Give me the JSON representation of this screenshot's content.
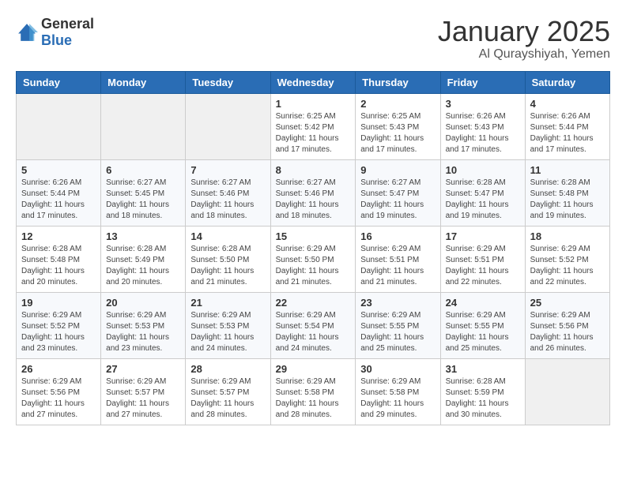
{
  "logo": {
    "general": "General",
    "blue": "Blue"
  },
  "header": {
    "month": "January 2025",
    "location": "Al Qurayshiyah, Yemen"
  },
  "weekdays": [
    "Sunday",
    "Monday",
    "Tuesday",
    "Wednesday",
    "Thursday",
    "Friday",
    "Saturday"
  ],
  "rows": [
    [
      {
        "day": "",
        "sunrise": "",
        "sunset": "",
        "daylight": ""
      },
      {
        "day": "",
        "sunrise": "",
        "sunset": "",
        "daylight": ""
      },
      {
        "day": "",
        "sunrise": "",
        "sunset": "",
        "daylight": ""
      },
      {
        "day": "1",
        "sunrise": "Sunrise: 6:25 AM",
        "sunset": "Sunset: 5:42 PM",
        "daylight": "Daylight: 11 hours and 17 minutes."
      },
      {
        "day": "2",
        "sunrise": "Sunrise: 6:25 AM",
        "sunset": "Sunset: 5:43 PM",
        "daylight": "Daylight: 11 hours and 17 minutes."
      },
      {
        "day": "3",
        "sunrise": "Sunrise: 6:26 AM",
        "sunset": "Sunset: 5:43 PM",
        "daylight": "Daylight: 11 hours and 17 minutes."
      },
      {
        "day": "4",
        "sunrise": "Sunrise: 6:26 AM",
        "sunset": "Sunset: 5:44 PM",
        "daylight": "Daylight: 11 hours and 17 minutes."
      }
    ],
    [
      {
        "day": "5",
        "sunrise": "Sunrise: 6:26 AM",
        "sunset": "Sunset: 5:44 PM",
        "daylight": "Daylight: 11 hours and 17 minutes."
      },
      {
        "day": "6",
        "sunrise": "Sunrise: 6:27 AM",
        "sunset": "Sunset: 5:45 PM",
        "daylight": "Daylight: 11 hours and 18 minutes."
      },
      {
        "day": "7",
        "sunrise": "Sunrise: 6:27 AM",
        "sunset": "Sunset: 5:46 PM",
        "daylight": "Daylight: 11 hours and 18 minutes."
      },
      {
        "day": "8",
        "sunrise": "Sunrise: 6:27 AM",
        "sunset": "Sunset: 5:46 PM",
        "daylight": "Daylight: 11 hours and 18 minutes."
      },
      {
        "day": "9",
        "sunrise": "Sunrise: 6:27 AM",
        "sunset": "Sunset: 5:47 PM",
        "daylight": "Daylight: 11 hours and 19 minutes."
      },
      {
        "day": "10",
        "sunrise": "Sunrise: 6:28 AM",
        "sunset": "Sunset: 5:47 PM",
        "daylight": "Daylight: 11 hours and 19 minutes."
      },
      {
        "day": "11",
        "sunrise": "Sunrise: 6:28 AM",
        "sunset": "Sunset: 5:48 PM",
        "daylight": "Daylight: 11 hours and 19 minutes."
      }
    ],
    [
      {
        "day": "12",
        "sunrise": "Sunrise: 6:28 AM",
        "sunset": "Sunset: 5:48 PM",
        "daylight": "Daylight: 11 hours and 20 minutes."
      },
      {
        "day": "13",
        "sunrise": "Sunrise: 6:28 AM",
        "sunset": "Sunset: 5:49 PM",
        "daylight": "Daylight: 11 hours and 20 minutes."
      },
      {
        "day": "14",
        "sunrise": "Sunrise: 6:28 AM",
        "sunset": "Sunset: 5:50 PM",
        "daylight": "Daylight: 11 hours and 21 minutes."
      },
      {
        "day": "15",
        "sunrise": "Sunrise: 6:29 AM",
        "sunset": "Sunset: 5:50 PM",
        "daylight": "Daylight: 11 hours and 21 minutes."
      },
      {
        "day": "16",
        "sunrise": "Sunrise: 6:29 AM",
        "sunset": "Sunset: 5:51 PM",
        "daylight": "Daylight: 11 hours and 21 minutes."
      },
      {
        "day": "17",
        "sunrise": "Sunrise: 6:29 AM",
        "sunset": "Sunset: 5:51 PM",
        "daylight": "Daylight: 11 hours and 22 minutes."
      },
      {
        "day": "18",
        "sunrise": "Sunrise: 6:29 AM",
        "sunset": "Sunset: 5:52 PM",
        "daylight": "Daylight: 11 hours and 22 minutes."
      }
    ],
    [
      {
        "day": "19",
        "sunrise": "Sunrise: 6:29 AM",
        "sunset": "Sunset: 5:52 PM",
        "daylight": "Daylight: 11 hours and 23 minutes."
      },
      {
        "day": "20",
        "sunrise": "Sunrise: 6:29 AM",
        "sunset": "Sunset: 5:53 PM",
        "daylight": "Daylight: 11 hours and 23 minutes."
      },
      {
        "day": "21",
        "sunrise": "Sunrise: 6:29 AM",
        "sunset": "Sunset: 5:53 PM",
        "daylight": "Daylight: 11 hours and 24 minutes."
      },
      {
        "day": "22",
        "sunrise": "Sunrise: 6:29 AM",
        "sunset": "Sunset: 5:54 PM",
        "daylight": "Daylight: 11 hours and 24 minutes."
      },
      {
        "day": "23",
        "sunrise": "Sunrise: 6:29 AM",
        "sunset": "Sunset: 5:55 PM",
        "daylight": "Daylight: 11 hours and 25 minutes."
      },
      {
        "day": "24",
        "sunrise": "Sunrise: 6:29 AM",
        "sunset": "Sunset: 5:55 PM",
        "daylight": "Daylight: 11 hours and 25 minutes."
      },
      {
        "day": "25",
        "sunrise": "Sunrise: 6:29 AM",
        "sunset": "Sunset: 5:56 PM",
        "daylight": "Daylight: 11 hours and 26 minutes."
      }
    ],
    [
      {
        "day": "26",
        "sunrise": "Sunrise: 6:29 AM",
        "sunset": "Sunset: 5:56 PM",
        "daylight": "Daylight: 11 hours and 27 minutes."
      },
      {
        "day": "27",
        "sunrise": "Sunrise: 6:29 AM",
        "sunset": "Sunset: 5:57 PM",
        "daylight": "Daylight: 11 hours and 27 minutes."
      },
      {
        "day": "28",
        "sunrise": "Sunrise: 6:29 AM",
        "sunset": "Sunset: 5:57 PM",
        "daylight": "Daylight: 11 hours and 28 minutes."
      },
      {
        "day": "29",
        "sunrise": "Sunrise: 6:29 AM",
        "sunset": "Sunset: 5:58 PM",
        "daylight": "Daylight: 11 hours and 28 minutes."
      },
      {
        "day": "30",
        "sunrise": "Sunrise: 6:29 AM",
        "sunset": "Sunset: 5:58 PM",
        "daylight": "Daylight: 11 hours and 29 minutes."
      },
      {
        "day": "31",
        "sunrise": "Sunrise: 6:28 AM",
        "sunset": "Sunset: 5:59 PM",
        "daylight": "Daylight: 11 hours and 30 minutes."
      },
      {
        "day": "",
        "sunrise": "",
        "sunset": "",
        "daylight": ""
      }
    ]
  ]
}
